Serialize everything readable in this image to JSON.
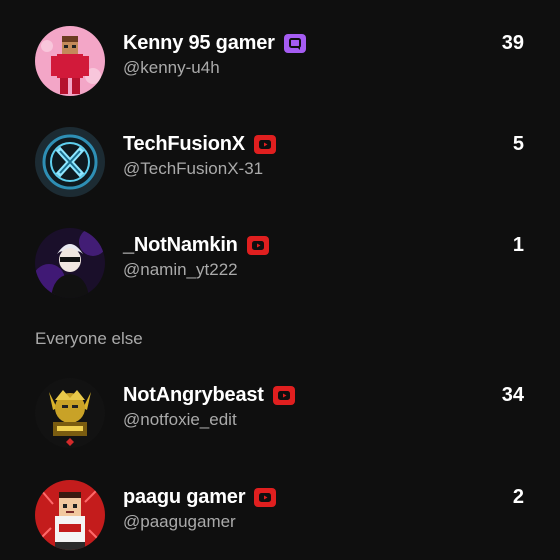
{
  "leaderboard": {
    "top": [
      {
        "name": "Kenny 95 gamer",
        "handle": "@kenny-u4h",
        "count": "39",
        "badge": "membership-chat-icon",
        "badge_color": "#a55cf2"
      },
      {
        "name": "TechFusionX",
        "handle": "@TechFusionX-31",
        "count": "5",
        "badge": "youtube-icon",
        "badge_color": "#e01f1f"
      },
      {
        "name": "_NotNamkin",
        "handle": "@namin_yt222",
        "count": "1",
        "badge": "youtube-icon",
        "badge_color": "#e01f1f"
      }
    ],
    "section_label": "Everyone else",
    "others": [
      {
        "name": "NotAngrybeast",
        "handle": "@notfoxie_edit",
        "count": "34",
        "badge": "youtube-icon",
        "badge_color": "#e01f1f"
      },
      {
        "name": "paagu gamer",
        "handle": "@paagugamer",
        "count": "2",
        "badge": "youtube-icon",
        "badge_color": "#e01f1f"
      }
    ]
  }
}
